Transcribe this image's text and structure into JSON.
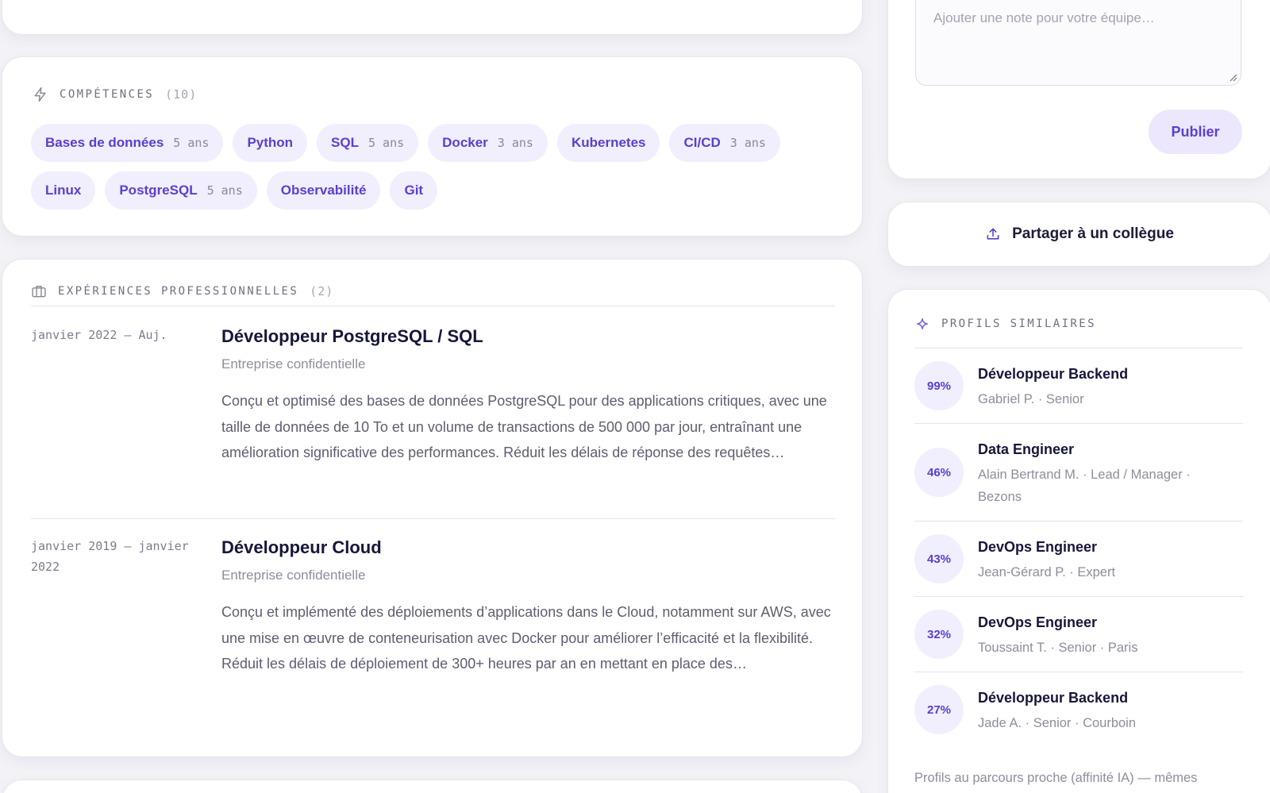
{
  "skills": {
    "title": "COMPÉTENCES",
    "count": "(10)",
    "items": [
      {
        "name": "Bases de données",
        "years": "5 ans"
      },
      {
        "name": "Python",
        "years": ""
      },
      {
        "name": "SQL",
        "years": "5 ans"
      },
      {
        "name": "Docker",
        "years": "3 ans"
      },
      {
        "name": "Kubernetes",
        "years": ""
      },
      {
        "name": "CI/CD",
        "years": "3 ans"
      },
      {
        "name": "Linux",
        "years": ""
      },
      {
        "name": "PostgreSQL",
        "years": "5 ans"
      },
      {
        "name": "Observabilité",
        "years": ""
      },
      {
        "name": "Git",
        "years": ""
      }
    ]
  },
  "experiences": {
    "title": "EXPÉRIENCES PROFESSIONNELLES",
    "count": "(2)",
    "items": [
      {
        "date": "janvier 2022 – Auj.",
        "title": "Développeur PostgreSQL / SQL",
        "company": "Entreprise confidentielle",
        "description": "Conçu et optimisé des bases de données PostgreSQL pour des applications critiques, avec une taille de données de 10 To et un volume de transactions de 500 000 par jour, entraînant une amélioration significative des performances. Réduit les délais de réponse des requêtes…"
      },
      {
        "date": "janvier 2019 – janvier 2022",
        "title": "Développeur Cloud",
        "company": "Entreprise confidentielle",
        "description": "Conçu et implémenté des déploiements d’applications dans le Cloud, notamment sur AWS, avec une mise en œuvre de conteneurisation avec Docker pour améliorer l’efficacité et la flexibilité. Réduit les délais de déploiement de 300+ heures par an en mettant en place des…"
      }
    ]
  },
  "note": {
    "placeholder": "Ajouter une note pour votre équipe…",
    "publish_label": "Publier"
  },
  "share": {
    "label": "Partager à un collègue"
  },
  "similar": {
    "title": "PROFILS SIMILAIRES",
    "items": [
      {
        "score": "99%",
        "title": "Développeur Backend",
        "subtitle": "Gabriel P. · Senior"
      },
      {
        "score": "46%",
        "title": "Data Engineer",
        "subtitle": "Alain Bertrand M. · Lead / Manager · Bezons"
      },
      {
        "score": "43%",
        "title": "DevOps Engineer",
        "subtitle": "Jean-Gérard P. · Expert"
      },
      {
        "score": "32%",
        "title": "DevOps Engineer",
        "subtitle": "Toussaint T. · Senior · Paris"
      },
      {
        "score": "27%",
        "title": "Développeur Backend",
        "subtitle": "Jade A. · Senior · Courboin"
      }
    ],
    "footnote": "Profils au parcours proche (affinité IA) — mêmes"
  },
  "colors": {
    "accent": "#5b3fd1",
    "chip_bg": "#f1eefd",
    "page_bg": "#f3f3f7"
  }
}
